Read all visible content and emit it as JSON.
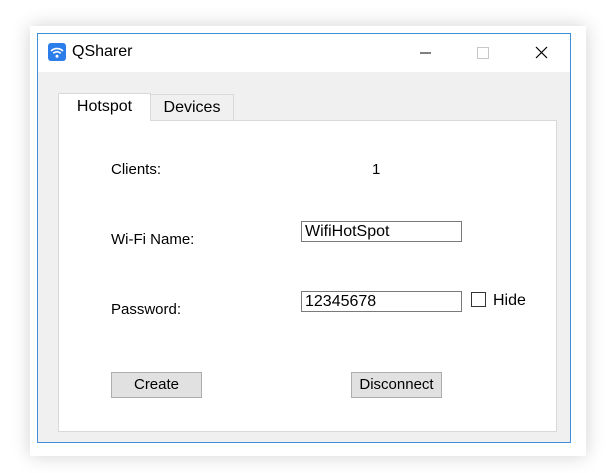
{
  "window": {
    "title": "QSharer",
    "icon": "wifi-app-icon",
    "accent_color": "#3d8fd8"
  },
  "tabs": [
    {
      "label": "Hotspot",
      "active": true
    },
    {
      "label": "Devices",
      "active": false
    }
  ],
  "hotspot": {
    "clients_label": "Clients:",
    "clients_value": "1",
    "wifi_name_label": "Wi-Fi Name:",
    "wifi_name_value": "WifiHotSpot",
    "password_label": "Password:",
    "password_value": "12345678",
    "hide_label": "Hide",
    "hide_checked": false,
    "create_label": "Create",
    "disconnect_label": "Disconnect"
  }
}
